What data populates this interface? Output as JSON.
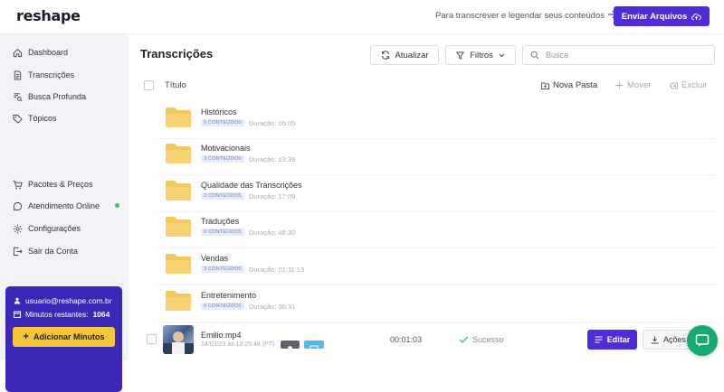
{
  "app": {
    "logo": "reshape"
  },
  "header": {
    "promo_text": "Para transcrever e legendar seus conteúdos",
    "send_label": "Enviar Arquivos"
  },
  "sidebar": {
    "items": [
      {
        "label": "Dashboard",
        "icon": "home-icon"
      },
      {
        "label": "Transcrições",
        "icon": "document-icon"
      },
      {
        "label": "Busca Profunda",
        "icon": "search-doc-icon"
      },
      {
        "label": "Tópicos",
        "icon": "tag-icon"
      },
      {
        "label": "Pacotes & Preços",
        "icon": "cart-icon"
      },
      {
        "label": "Atendimento Online",
        "icon": "chat-icon"
      },
      {
        "label": "Configurações",
        "icon": "gear-icon"
      },
      {
        "label": "Sair da Conta",
        "icon": "logout-icon"
      }
    ],
    "account": {
      "email": "usuario@reshape.com.br",
      "minutes_label": "Minutos restantes:",
      "minutes_value": "1064",
      "add_label": "Adicionar Minutos"
    }
  },
  "main": {
    "title": "Transcrições",
    "refresh_label": "Atualizar",
    "filter_label": "Filtros",
    "search_placeholder": "Busca",
    "column_title": "Título",
    "new_folder_label": "Nova Pasta",
    "move_label": "Mover",
    "delete_label": "Excluir",
    "folders": [
      {
        "name": "Históricos",
        "count": "5 CONTEÚDOS",
        "duration": "Duração: 05:05"
      },
      {
        "name": "Motivacionais",
        "count": "3 CONTEÚDOS",
        "duration": "Duração: 23:39"
      },
      {
        "name": "Qualidade das Transcrições",
        "count": "3 CONTEÚDOS",
        "duration": "Duração: 17:09"
      },
      {
        "name": "Traduções",
        "count": "9 CONTEÚDOS",
        "duration": "Duração: 48:30"
      },
      {
        "name": "Vendas",
        "count": "3 CONTEÚDOS",
        "duration": "Duração: 01:11:13"
      },
      {
        "name": "Entretenimento",
        "count": "9 CONTEÚDOS",
        "duration": "Duração: 30:31"
      }
    ],
    "file": {
      "name": "Emilio.mp4",
      "date": "14/03/23 às 13:25:48 (PT)",
      "duration": "00:01:03",
      "status": "Sucesso",
      "edit_label": "Editar",
      "actions_label": "Ações"
    }
  },
  "colors": {
    "accent": "#4f2dd6",
    "account_bg": "#3b28b8",
    "add_button": "#f5c53a",
    "folder": "#f3c85b",
    "success": "#39c46a",
    "chat": "#17a972"
  }
}
